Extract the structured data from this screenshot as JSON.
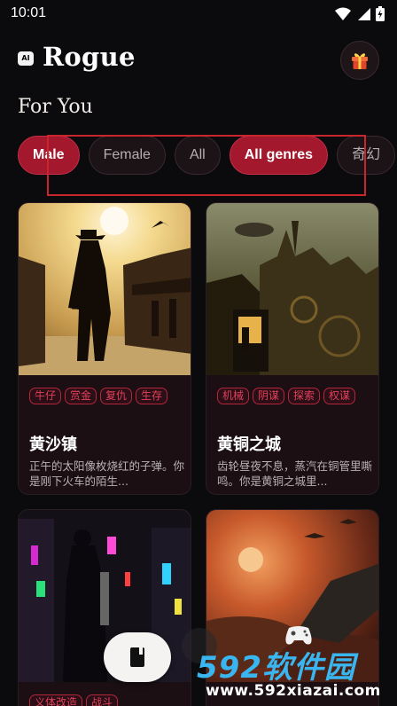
{
  "status_bar": {
    "time": "10:01"
  },
  "header": {
    "logo_text": "AI",
    "app_name": "Rogue"
  },
  "section_title": "For You",
  "chips": [
    {
      "label": "Male",
      "active": true
    },
    {
      "label": "Female",
      "active": false
    },
    {
      "label": "All",
      "active": false
    },
    {
      "label": "All genres",
      "active": true
    },
    {
      "label": "奇幻",
      "active": false
    }
  ],
  "cards": [
    {
      "tags": [
        "牛仔",
        "赏金",
        "复仇",
        "生存"
      ],
      "title": "黄沙镇",
      "desc": "正午的太阳像枚烧红的子弹。你是刚下火车的陌生..."
    },
    {
      "tags": [
        "机械",
        "阴谋",
        "探索",
        "权谋"
      ],
      "title": "黄铜之城",
      "desc": "齿轮昼夜不息，蒸汽在铜管里嘶鸣。你是黄铜之城里..."
    },
    {
      "tags": [
        "义体改造",
        "战斗"
      ]
    },
    {
      "tags": []
    }
  ],
  "watermark": {
    "top": "592软件园",
    "bottom": "www.592xiazai.com"
  },
  "colors": {
    "accent": "#a3182d",
    "tag": "#e0405a",
    "background": "#0b0a0c"
  }
}
